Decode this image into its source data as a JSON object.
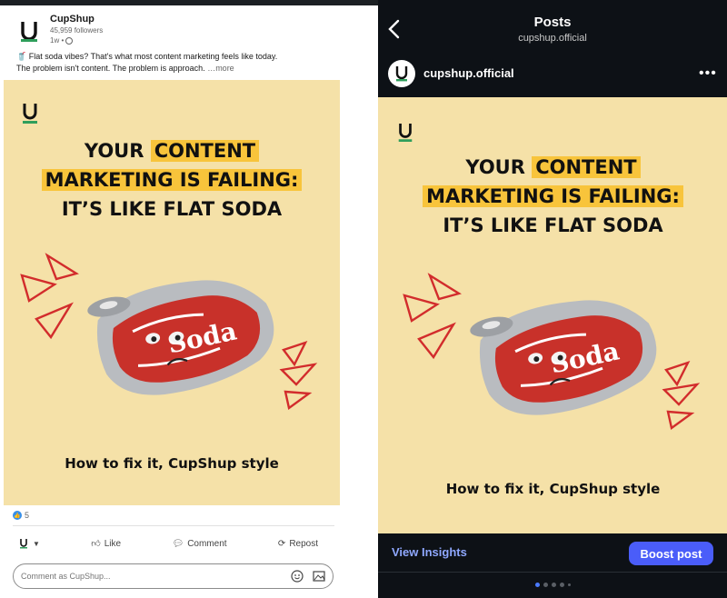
{
  "linkedin": {
    "company_name": "CupShup",
    "followers": "45,959 followers",
    "time": "1w •",
    "post_text_line1": "Flat soda vibes? That's what most content marketing feels like today.",
    "post_text_line2": "The problem isn't content. The problem is approach.",
    "more_label": "…more",
    "reaction_count": "5",
    "actions": {
      "like": "Like",
      "comment": "Comment",
      "repost": "Repost"
    },
    "comment_placeholder": "Comment as CupShup..."
  },
  "creative": {
    "headline_line1_plain": "YOUR ",
    "headline_line1_highlight": "CONTENT",
    "headline_line2_highlight": "MARKETING IS FAILING:",
    "headline_line3": "IT’S LIKE FLAT SODA",
    "can_text": "Soda",
    "caption": "How to fix it, CupShup style",
    "background_color": "#f5e1a8",
    "highlight_color": "#f8c43b",
    "brand_green": "#2e9e5b"
  },
  "instagram": {
    "header_title": "Posts",
    "header_subtitle": "cupshup.official",
    "username": "cupshup.official",
    "more_icon": "•••",
    "view_insights": "View Insights",
    "boost_post": "Boost post",
    "accent_color": "#4a5df9"
  }
}
